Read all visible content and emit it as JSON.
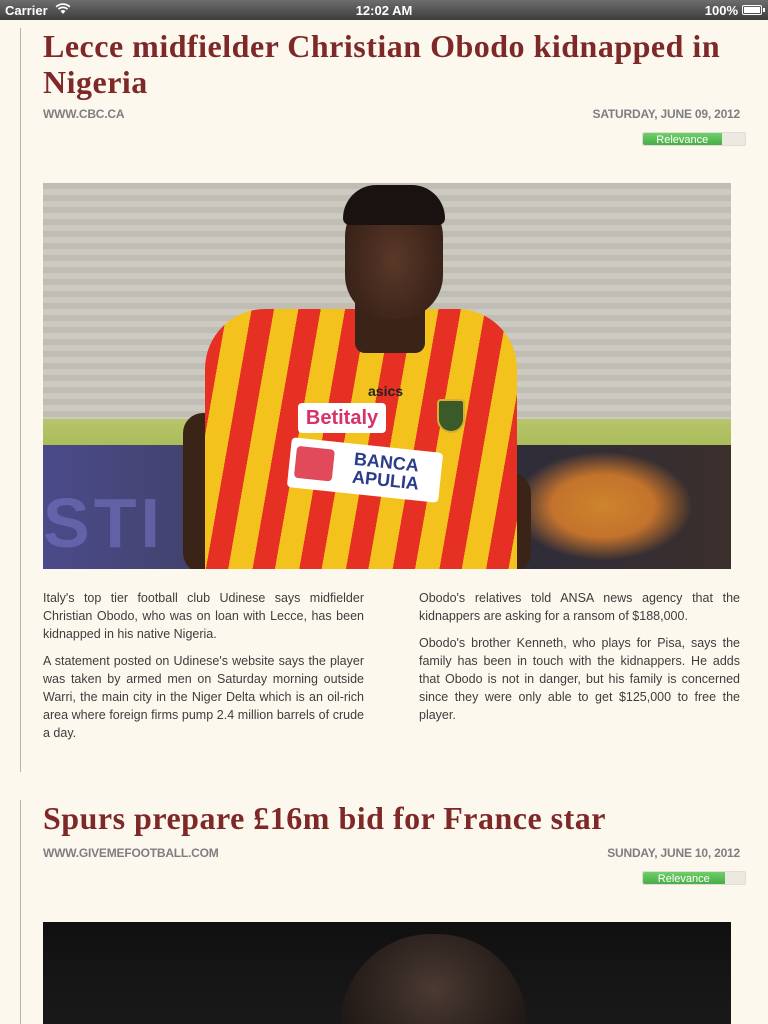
{
  "status_bar": {
    "carrier": "Carrier",
    "time": "12:02 AM",
    "battery": "100%"
  },
  "articles": [
    {
      "headline": "Lecce midfielder Christian Obodo kidnapped in Nigeria",
      "source": "WWW.CBC.CA",
      "date": "SATURDAY, JUNE 09, 2012",
      "relevance_label": "Relevance",
      "relevance_fraction": 0.77,
      "image_description": "football-player-photo",
      "image_text": {
        "sponsor_1": "Betitaly",
        "sponsor_2_line1": "BANCA",
        "sponsor_2_line2": "APULIA",
        "brand": "asics",
        "board": "STI"
      },
      "columns": {
        "left": [
          "Italy's top tier football club Udinese says midfielder Christian Obodo, who was on loan with Lecce, has been kidnapped in his native Nigeria.",
          "A statement posted on Udinese's website says the player was taken by armed men on Saturday morning outside Warri, the main city in the Niger Delta which is an oil-rich area where foreign firms pump 2.4 million barrels of crude a day."
        ],
        "right": [
          "Obodo's relatives told ANSA news agency that the kidnappers are asking for a ransom of $188,000.",
          "Obodo's brother Kenneth, who plays for Pisa, says the family has been in touch with the kidnappers. He adds that Obodo is not in danger, but his family is concerned since they were only able to get $125,000 to free the player."
        ]
      }
    },
    {
      "headline": "Spurs prepare £16m bid for France star",
      "source": "WWW.GIVEMEFOOTBALL.COM",
      "date": "SUNDAY, JUNE 10, 2012",
      "relevance_label": "Relevance",
      "relevance_fraction": 0.8
    }
  ],
  "colors": {
    "background": "#fdf8ee",
    "headline": "#7f2828",
    "meta": "#7e7e82",
    "relevance_green": "#4fb54c"
  }
}
